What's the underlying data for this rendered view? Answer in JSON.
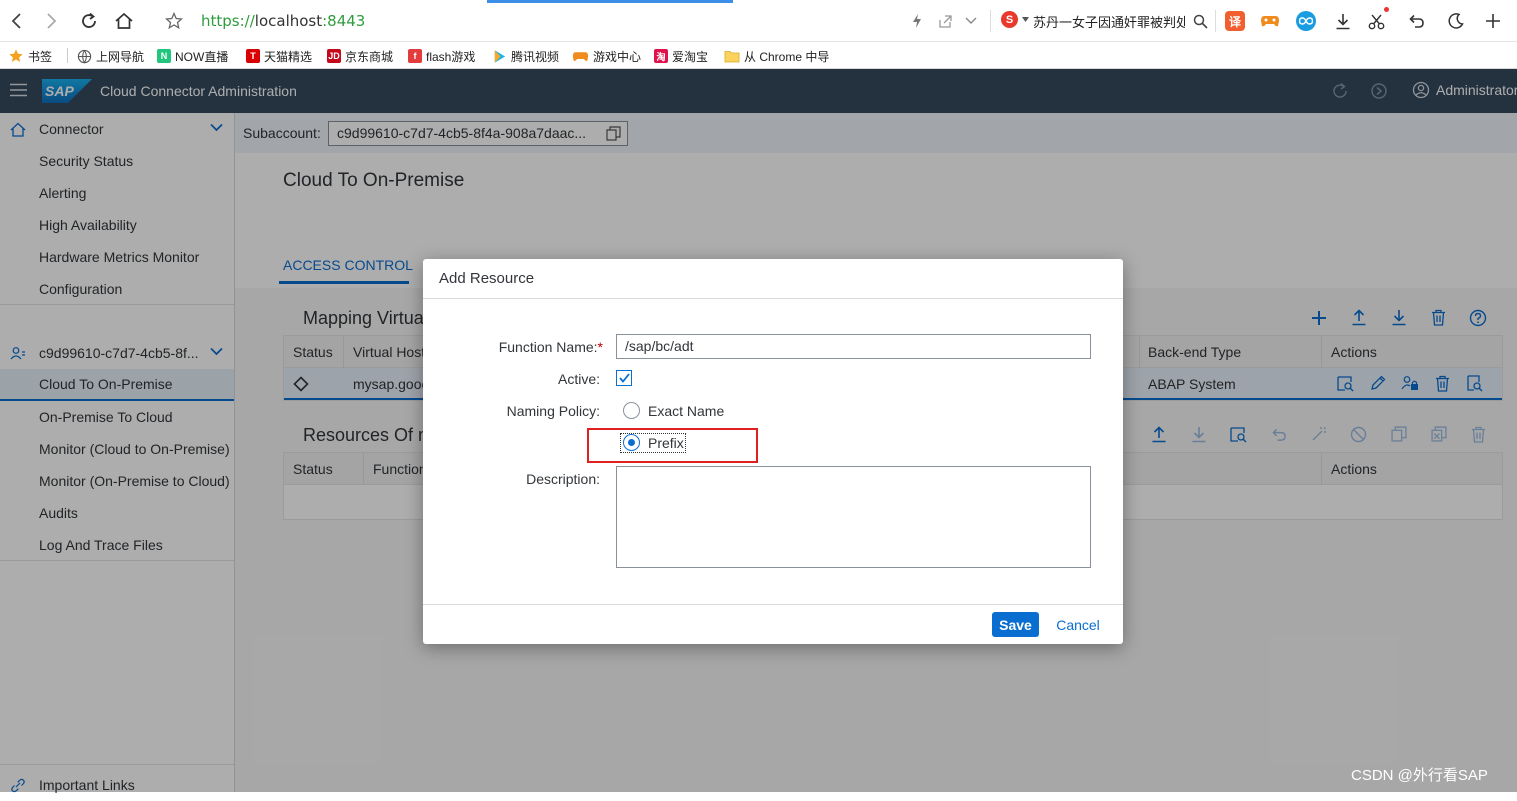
{
  "browser": {
    "url_scheme": "https://",
    "url_host": "localhost",
    "url_port": ":8443",
    "news_text": "苏丹一女子因通奸罪被判处",
    "search_engine_letter": "S",
    "ext_translate": "译",
    "bookmarks": [
      {
        "label": "书签",
        "icon": "star-icon"
      },
      {
        "label": "上网导航",
        "icon": "globe-icon"
      },
      {
        "label": "NOW直播",
        "icon": "now-icon"
      },
      {
        "label": "天猫精选",
        "icon": "tmall-icon"
      },
      {
        "label": "京东商城",
        "icon": "jd-icon"
      },
      {
        "label": "flash游戏",
        "icon": "flash-icon"
      },
      {
        "label": "腾讯视频",
        "icon": "video-icon"
      },
      {
        "label": "游戏中心",
        "icon": "game-icon"
      },
      {
        "label": "爱淘宝",
        "icon": "taobao-icon"
      },
      {
        "label": "从 Chrome 中导",
        "icon": "folder-icon"
      }
    ]
  },
  "shell": {
    "logo_text": "SAP",
    "title": "Cloud Connector Administration",
    "user": "Administrator"
  },
  "sidebar": {
    "connector_group": "Connector",
    "connector_items": [
      "Security Status",
      "Alerting",
      "High Availability",
      "Hardware Metrics Monitor",
      "Configuration"
    ],
    "subaccount_group": "c9d99610-c7d7-4cb5-8f...",
    "subaccount_items": [
      "Cloud To On-Premise",
      "On-Premise To Cloud",
      "Monitor (Cloud to On-Premise)",
      "Monitor (On-Premise to Cloud)",
      "Audits",
      "Log And Trace Files"
    ],
    "footer": "Important Links"
  },
  "content": {
    "subaccount_label": "Subaccount:",
    "subaccount_value": "c9d99610-c7d7-4cb5-8f4a-908a7daac...",
    "page_title": "Cloud To On-Premise",
    "tab": "ACCESS CONTROL",
    "mapping_title": "Mapping Virtua",
    "mapping_headers": {
      "status": "Status",
      "virtual_host": "Virtual Host",
      "backend_type": "Back-end Type",
      "actions": "Actions"
    },
    "mapping_row": {
      "virtual_host": "mysap.gooc",
      "backend_type": "ABAP System"
    },
    "resources_title": "Resources Of m",
    "resources_headers": {
      "status": "Status",
      "function": "Function",
      "actions": "Actions"
    }
  },
  "dialog": {
    "title": "Add Resource",
    "function_name_label": "Function Name:",
    "required_mark": "*",
    "function_name_value": "/sap/bc/adt",
    "active_label": "Active:",
    "active_checked": true,
    "naming_policy_label": "Naming Policy:",
    "option_exact": "Exact Name",
    "option_prefix": "Prefix",
    "selected_option": "Prefix",
    "description_label": "Description:",
    "description_value": "",
    "save": "Save",
    "cancel": "Cancel"
  },
  "watermark": "CSDN @外行看SAP",
  "colors": {
    "shell": "#354a5f",
    "accent": "#0a6ed1",
    "highlight_box": "#e02020"
  }
}
